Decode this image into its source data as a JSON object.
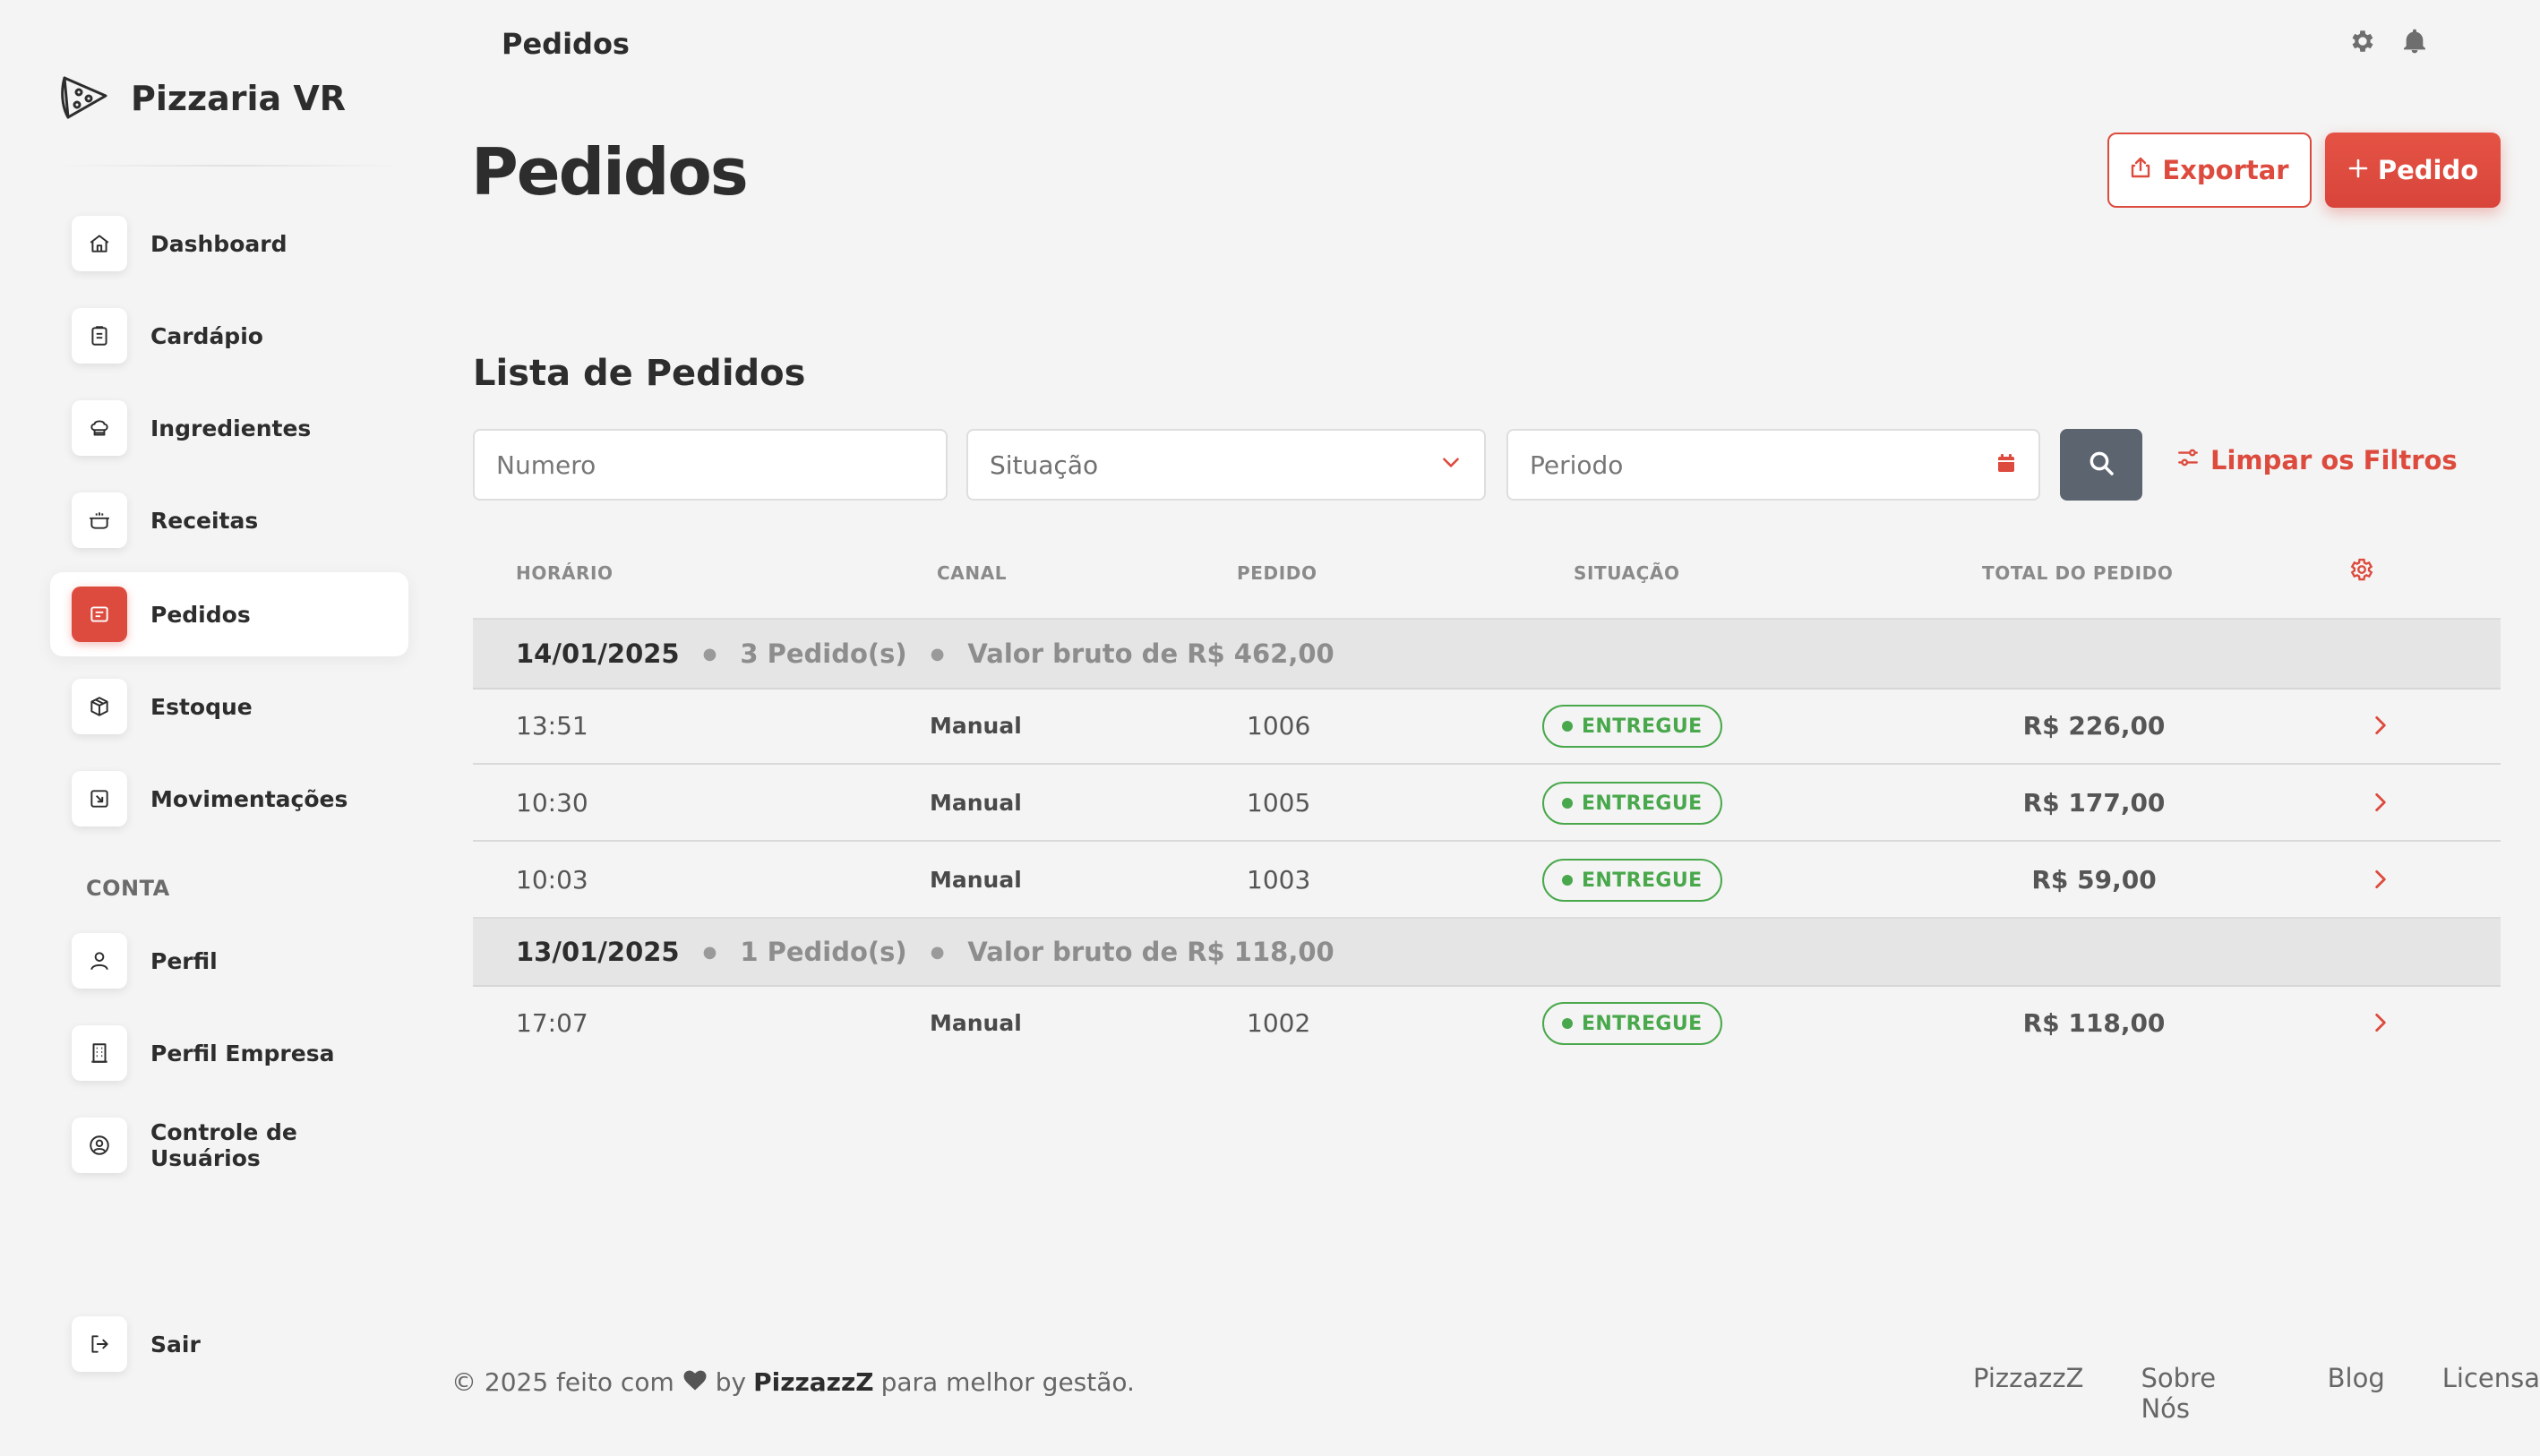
{
  "brand": {
    "name": "Pizzaria VR"
  },
  "sidebar": {
    "items": [
      {
        "label": "Dashboard",
        "icon": "home-icon"
      },
      {
        "label": "Cardápio",
        "icon": "clipboard-icon"
      },
      {
        "label": "Ingredientes",
        "icon": "chef-hat-icon"
      },
      {
        "label": "Receitas",
        "icon": "pot-icon"
      },
      {
        "label": "Pedidos",
        "icon": "receipt-icon"
      },
      {
        "label": "Estoque",
        "icon": "box-icon"
      },
      {
        "label": "Movimentações",
        "icon": "transfer-icon"
      }
    ],
    "section_label": "CONTA",
    "account_items": [
      {
        "label": "Perfil",
        "icon": "user-icon"
      },
      {
        "label": "Perfil Empresa",
        "icon": "building-icon"
      },
      {
        "label": "Controle de Usuários",
        "icon": "user-circle-icon"
      }
    ],
    "logout_label": "Sair"
  },
  "topbar": {
    "title": "Pedidos"
  },
  "page": {
    "title": "Pedidos",
    "export_label": "Exportar",
    "new_label": "Pedido",
    "list_title": "Lista de Pedidos"
  },
  "filters": {
    "numero_placeholder": "Numero",
    "situacao_value": "Situação",
    "periodo_placeholder": "Periodo",
    "clear_label": "Limpar os Filtros"
  },
  "table": {
    "headers": {
      "horario": "HORÁRIO",
      "canal": "CANAL",
      "pedido": "PEDIDO",
      "situacao": "SITUAÇÃO",
      "total": "TOTAL DO PEDIDO"
    },
    "groups": [
      {
        "date": "14/01/2025",
        "count": "3 Pedido(s)",
        "gross": "Valor bruto de R$ 462,00",
        "rows": [
          {
            "time": "13:51",
            "canal": "Manual",
            "pedido": "1006",
            "status": "ENTREGUE",
            "total": "R$ 226,00"
          },
          {
            "time": "10:30",
            "canal": "Manual",
            "pedido": "1005",
            "status": "ENTREGUE",
            "total": "R$ 177,00"
          },
          {
            "time": "10:03",
            "canal": "Manual",
            "pedido": "1003",
            "status": "ENTREGUE",
            "total": "R$ 59,00"
          }
        ]
      },
      {
        "date": "13/01/2025",
        "count": "1 Pedido(s)",
        "gross": "Valor bruto de R$ 118,00",
        "rows": [
          {
            "time": "17:07",
            "canal": "Manual",
            "pedido": "1002",
            "status": "ENTREGUE",
            "total": "R$ 118,00"
          }
        ]
      }
    ]
  },
  "footer": {
    "text_before": "© 2025 feito com",
    "text_by": "by",
    "brand": "PizzazzZ",
    "text_after": "para melhor gestão.",
    "links": [
      "PizzazzZ",
      "Sobre Nós",
      "Blog",
      "Licensa"
    ]
  },
  "colors": {
    "accent": "#dd4b3e",
    "success": "#49a84b",
    "search_button": "#5c6470"
  }
}
